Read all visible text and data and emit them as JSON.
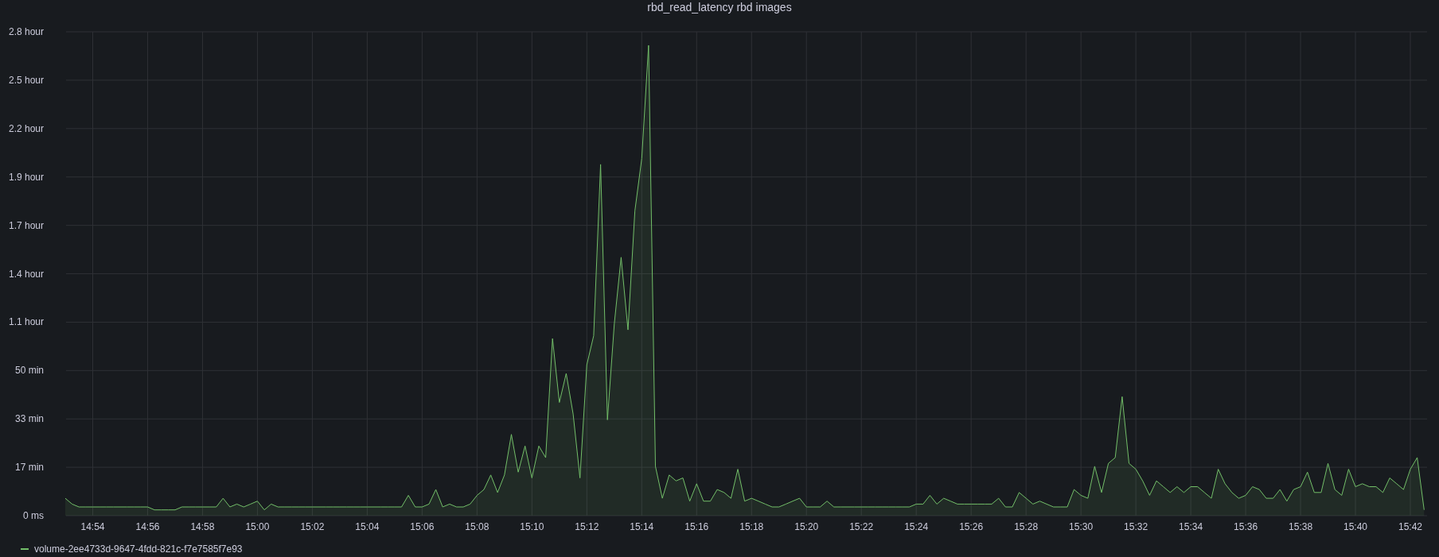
{
  "panel": {
    "title": "rbd_read_latency rbd images",
    "y_axis_hour_labels": [
      "2.8 hour",
      "2.5 hour",
      "2.2 hour",
      "1.9 hour",
      "1.7 hour",
      "1.4 hour",
      "1.1 hour"
    ],
    "chart_data": {
      "type": "area",
      "grid": true,
      "ylim": [
        0,
        166.67
      ],
      "yticks": [
        {
          "value": 0,
          "label": "0 ms"
        },
        {
          "value": 16.67,
          "label": "17 min"
        },
        {
          "value": 33.33,
          "label": "33 min"
        },
        {
          "value": 50,
          "label": "50 min"
        }
      ],
      "categories": [
        null,
        null,
        null,
        null,
        "14:54",
        null,
        null,
        null,
        null,
        null,
        null,
        null,
        "14:56",
        null,
        null,
        null,
        null,
        null,
        null,
        null,
        "14:58",
        null,
        null,
        null,
        null,
        null,
        null,
        null,
        "15:00",
        null,
        null,
        null,
        null,
        null,
        null,
        null,
        "15:02",
        null,
        null,
        null,
        null,
        null,
        null,
        null,
        "15:04",
        null,
        null,
        null,
        null,
        null,
        null,
        null,
        "15:06",
        null,
        null,
        null,
        null,
        null,
        null,
        null,
        "15:08",
        null,
        null,
        null,
        null,
        null,
        null,
        null,
        "15:10",
        null,
        null,
        null,
        null,
        null,
        null,
        null,
        "15:12",
        null,
        null,
        null,
        null,
        null,
        null,
        null,
        "15:14",
        null,
        null,
        null,
        null,
        null,
        null,
        null,
        "15:16",
        null,
        null,
        null,
        null,
        null,
        null,
        null,
        "15:18",
        null,
        null,
        null,
        null,
        null,
        null,
        null,
        "15:20",
        null,
        null,
        null,
        null,
        null,
        null,
        null,
        "15:22",
        null,
        null,
        null,
        null,
        null,
        null,
        null,
        "15:24",
        null,
        null,
        null,
        null,
        null,
        null,
        null,
        "15:26",
        null,
        null,
        null,
        null,
        null,
        null,
        null,
        "15:28",
        null,
        null,
        null,
        null,
        null,
        null,
        null,
        "15:30",
        null,
        null,
        null,
        null,
        null,
        null,
        null,
        "15:32",
        null,
        null,
        null,
        null,
        null,
        null,
        null,
        "15:34",
        null,
        null,
        null,
        null,
        null,
        null,
        null,
        "15:36",
        null,
        null,
        null,
        null,
        null,
        null,
        null,
        "15:38",
        null,
        null,
        null,
        null,
        null,
        null,
        null,
        "15:40",
        null,
        null,
        null,
        null,
        null,
        null,
        null,
        "15:42",
        null,
        null
      ],
      "series": [
        {
          "name": "volume-2ee4733d-9647-4fdd-821c-f7e7585f7e93",
          "color": "#73bf69",
          "values": [
            6,
            4,
            3,
            3,
            3,
            3,
            3,
            3,
            3,
            3,
            3,
            3,
            3,
            2,
            2,
            2,
            2,
            3,
            3,
            3,
            3,
            3,
            3,
            6,
            3,
            4,
            3,
            4,
            5,
            2,
            4,
            3,
            3,
            3,
            3,
            3,
            3,
            3,
            3,
            3,
            3,
            3,
            3,
            3,
            3,
            3,
            3,
            3,
            3,
            3,
            7,
            3,
            3,
            4,
            9,
            3,
            4,
            3,
            3,
            4,
            7,
            9,
            14,
            8,
            14,
            28,
            15,
            24,
            13,
            24,
            20,
            61,
            39,
            49,
            35,
            13,
            52,
            62,
            121,
            33,
            66,
            89,
            64,
            105,
            123,
            162,
            17,
            6,
            14,
            12,
            13,
            5,
            11,
            5,
            5,
            9,
            8,
            6,
            16,
            5,
            6,
            5,
            4,
            3,
            3,
            4,
            5,
            6,
            3,
            3,
            3,
            5,
            3,
            3,
            3,
            3,
            3,
            3,
            3,
            3,
            3,
            3,
            3,
            3,
            4,
            4,
            7,
            4,
            6,
            5,
            4,
            4,
            4,
            4,
            4,
            4,
            6,
            3,
            3,
            8,
            6,
            4,
            5,
            4,
            3,
            3,
            3,
            9,
            7,
            6,
            17,
            8,
            18,
            20,
            41,
            18,
            16,
            12,
            7,
            12,
            10,
            8,
            10,
            8,
            10,
            10,
            8,
            6,
            16,
            11,
            8,
            6,
            7,
            10,
            9,
            6,
            6,
            9,
            5,
            9,
            10,
            15,
            8,
            8,
            18,
            9,
            7,
            16,
            10,
            11,
            10,
            10,
            8,
            13,
            11,
            9,
            16,
            20,
            2
          ]
        }
      ]
    }
  }
}
